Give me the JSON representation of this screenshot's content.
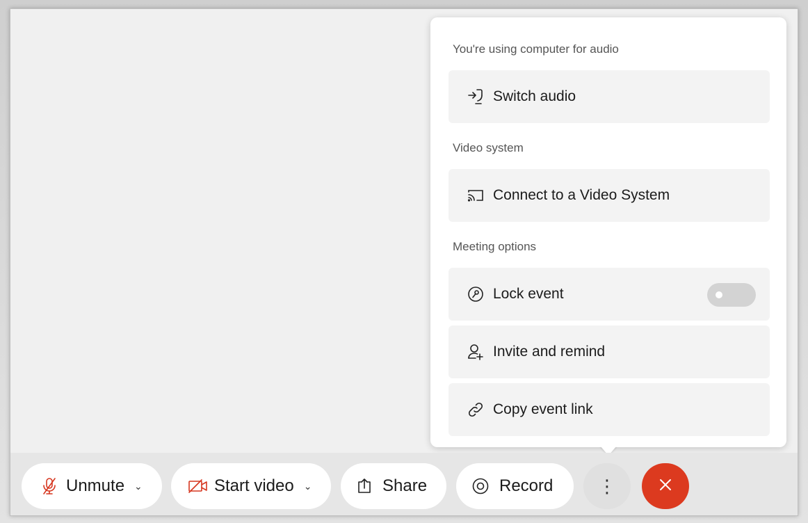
{
  "menu": {
    "audio_section": "You're using computer for audio",
    "switch_audio": "Switch audio",
    "video_section": "Video system",
    "connect_video": "Connect to a Video System",
    "meeting_section": "Meeting options",
    "lock_event": "Lock event",
    "lock_event_enabled": false,
    "invite_remind": "Invite and remind",
    "copy_link": "Copy event link"
  },
  "toolbar": {
    "unmute": "Unmute",
    "start_video": "Start video",
    "share": "Share",
    "record": "Record",
    "more_glyph": "⋮"
  },
  "colors": {
    "danger": "#dc3a1f",
    "muted_icon": "#d6361f"
  },
  "icons": {
    "switch_audio": "switch-audio-icon",
    "connect_video": "cast-icon",
    "lock_event": "lock-key-icon",
    "invite_remind": "add-person-icon",
    "copy_link": "link-icon",
    "unmute": "mic-muted-icon",
    "start_video": "camera-off-icon",
    "share": "share-icon",
    "record": "record-icon",
    "end": "close-icon"
  }
}
